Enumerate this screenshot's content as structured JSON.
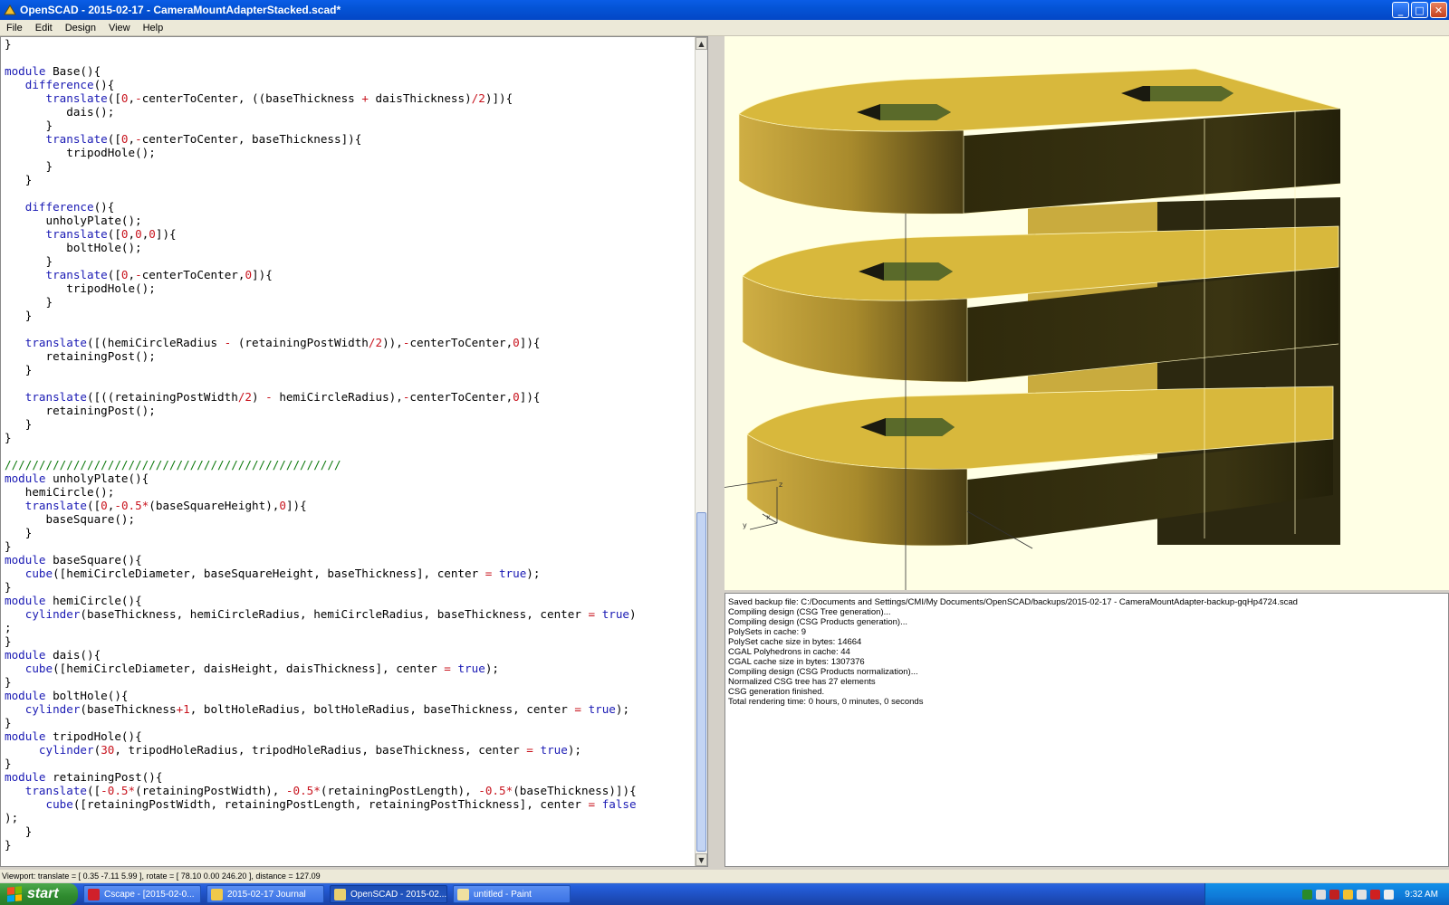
{
  "window": {
    "title": "OpenSCAD - 2015-02-17 - CameraMountAdapterStacked.scad*",
    "minimize_icon": "minimize-icon",
    "maximize_icon": "maximize-icon",
    "close_icon": "close-icon"
  },
  "menu": [
    "File",
    "Edit",
    "Design",
    "View",
    "Help"
  ],
  "editor": {
    "lines": [
      "}",
      "",
      "module Base(){",
      "   difference(){",
      "      translate([0,-centerToCenter, ((baseThickness + daisThickness)/2)]){",
      "         dais();",
      "      }",
      "      translate([0,-centerToCenter, baseThickness]){",
      "         tripodHole();",
      "      }",
      "   }",
      "",
      "   difference(){",
      "      unholyPlate();",
      "      translate([0,0,0]){",
      "         boltHole();",
      "      }",
      "      translate([0,-centerToCenter,0]){",
      "         tripodHole();",
      "      }",
      "   }",
      "",
      "   translate([(hemiCircleRadius - (retainingPostWidth/2)),-centerToCenter,0]){",
      "      retainingPost();",
      "   }",
      "",
      "   translate([((retainingPostWidth/2) - hemiCircleRadius),-centerToCenter,0]){",
      "      retainingPost();",
      "   }",
      "}",
      "",
      "/////////////////////////////////////////////////",
      "module unholyPlate(){",
      "   hemiCircle();",
      "   translate([0,-0.5*(baseSquareHeight),0]){",
      "      baseSquare();",
      "   }",
      "}",
      "module baseSquare(){",
      "   cube([hemiCircleDiameter, baseSquareHeight, baseThickness], center = true);",
      "}",
      "module hemiCircle(){",
      "   cylinder(baseThickness, hemiCircleRadius, hemiCircleRadius, baseThickness, center = true)",
      ";",
      "}",
      "module dais(){",
      "   cube([hemiCircleDiameter, daisHeight, daisThickness], center = true);",
      "}",
      "module boltHole(){",
      "   cylinder(baseThickness+1, boltHoleRadius, boltHoleRadius, baseThickness, center = true);",
      "}",
      "module tripodHole(){",
      "     cylinder(30, tripodHoleRadius, tripodHoleRadius, baseThickness, center = true);",
      "}",
      "module retainingPost(){",
      "   translate([-0.5*(retainingPostWidth), -0.5*(retainingPostLength), -0.5*(baseThickness)]){",
      "      cube([retainingPostWidth, retainingPostLength, retainingPostThickness], center = false",
      ");",
      "   }",
      "}"
    ],
    "keywords": [
      "module",
      "difference",
      "translate",
      "cube",
      "cylinder",
      "true",
      "false"
    ]
  },
  "viewport": {
    "axis_labels": {
      "z": "z",
      "y": "y",
      "x": "x"
    }
  },
  "console": {
    "lines": [
      "Saved backup file: C:/Documents and Settings/CMI/My Documents/OpenSCAD/backups/2015-02-17 - CameraMountAdapter-backup-gqHp4724.scad",
      "Compiling design (CSG Tree generation)...",
      "Compiling design (CSG Products generation)...",
      "PolySets in cache: 9",
      "PolySet cache size in bytes: 14664",
      "CGAL Polyhedrons in cache: 44",
      "CGAL cache size in bytes: 1307376",
      "Compiling design (CSG Products normalization)...",
      "Normalized CSG tree has 27 elements",
      "CSG generation finished.",
      "Total rendering time: 0 hours, 0 minutes, 0 seconds"
    ]
  },
  "statusbar": {
    "text": "Viewport: translate = [ 0.35 -7.11 5.99 ], rotate = [ 78.10 0.00 246.20 ], distance = 127.09"
  },
  "taskbar": {
    "start_label": "start",
    "tasks": [
      {
        "label": "Cscape - [2015-02-0...",
        "icon": "cscape-icon",
        "color": "#d0202a"
      },
      {
        "label": "2015-02-17 Journal",
        "icon": "folder-icon",
        "color": "#f0c94a"
      },
      {
        "label": "OpenSCAD - 2015-02...",
        "icon": "openscad-icon",
        "color": "#e8d070",
        "active": true
      },
      {
        "label": "untitled - Paint",
        "icon": "paint-icon",
        "color": "#f0e0a0"
      }
    ],
    "clock": "9:32 AM"
  },
  "colors": {
    "model_top": "#d8b83c",
    "model_side_light": "#c8a83a",
    "model_side_dark": "#3a3210",
    "viewport_bg": "#ffffe5"
  }
}
